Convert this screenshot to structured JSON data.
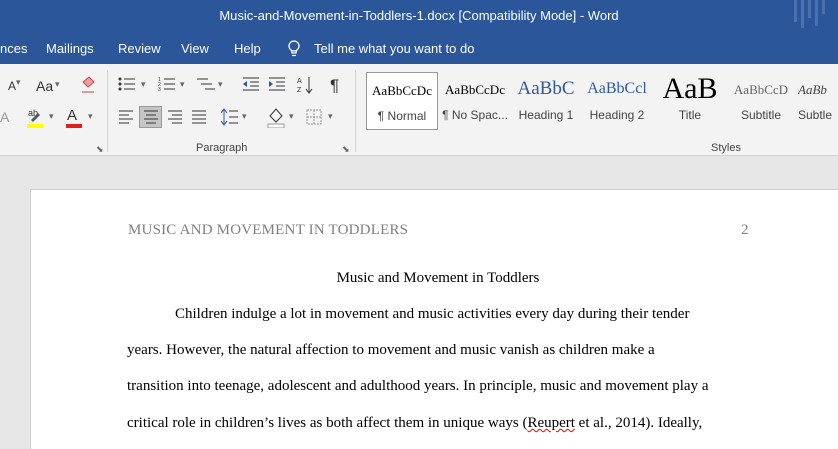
{
  "titlebar": {
    "title": "Music-and-Movement-in-Toddlers-1.docx [Compatibility Mode]  -  Word"
  },
  "tabs": [
    "nces",
    "Mailings",
    "Review",
    "View",
    "Help"
  ],
  "tell_me": "Tell me what you want to do",
  "ribbon": {
    "font_partial": "A",
    "change_case": "Aa",
    "paragraph_label": "Paragraph",
    "styles_label": "Styles",
    "pilcrow": "¶",
    "styles": [
      {
        "sample": "AaBbCcDc",
        "name": "¶ Normal",
        "selected": true
      },
      {
        "sample": "AaBbCcDc",
        "name": "¶ No Spac..."
      },
      {
        "sample": "AaBbC",
        "name": "Heading 1"
      },
      {
        "sample": "AaBbCcl",
        "name": "Heading 2"
      },
      {
        "sample": "AaB",
        "name": "Title"
      },
      {
        "sample": "AaBbCcD",
        "name": "Subtitle"
      },
      {
        "sample": "AaBb",
        "name": "Subtle"
      }
    ]
  },
  "document": {
    "running_head": "MUSIC AND MOVEMENT IN TODDLERS",
    "page_number": "2",
    "title": "Music and Movement in Toddlers",
    "lines": [
      "Children indulge a lot in movement and music activities every day during their tender",
      "years. However, the natural affection to movement and music vanish as children make a",
      "transition into teenage, adolescent and adulthood years. In principle, music and movement play a",
      "critical role in children’s lives as both affect them in unique ways (",
      "Reupert",
      " et al., 2014). Ideally,"
    ]
  },
  "colors": {
    "word_blue": "#2b579a",
    "ribbon_bg": "#f3f3f3",
    "canvas_bg": "#e6e6e6"
  }
}
